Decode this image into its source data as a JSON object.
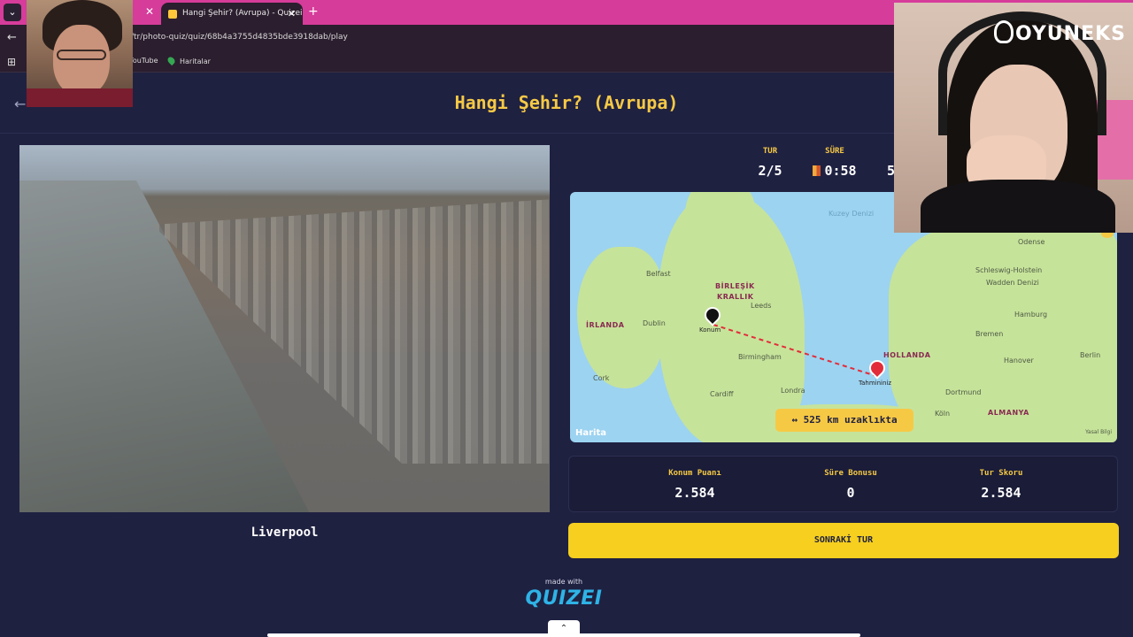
{
  "browser": {
    "active_tab_title": "Hangi Şehir? (Avrupa) - Quizei",
    "url": "/tr/photo-quiz/quiz/68b4a3755d4835bde3918dab/play",
    "bookmarks": [
      "YouTube",
      "Haritalar"
    ]
  },
  "page": {
    "title": "Hangi Şehir? (Avrupa)",
    "photo_caption": "Liverpool"
  },
  "stats": {
    "round_label": "TUR",
    "round_value": "2/5",
    "time_label": "SÜRE",
    "time_value": "0:58",
    "cut_value": "5"
  },
  "map": {
    "labels": {
      "ireland": "İRLANDA",
      "uk_line1": "BİRLEŞİK",
      "uk_line2": "KRALLIK",
      "netherlands": "HOLLANDA",
      "germany": "ALMANYA",
      "dublin": "Dublin",
      "belfast": "Belfast",
      "cork": "Cork",
      "leeds": "Leeds",
      "birmingham": "Birmingham",
      "cardiff": "Cardiff",
      "london": "Londra",
      "bremen": "Bremen",
      "hamburg": "Hamburg",
      "hanover": "Hanover",
      "berlin": "Berlin",
      "dortmund": "Dortmund",
      "koln": "Köln",
      "odense": "Odense",
      "schleswig": "Schleswig-Holstein",
      "wadden": "Wadden Denizi",
      "north_sea": "Kuzey Denizi"
    },
    "marker_actual_label": "Konum",
    "marker_guess_label": "Tahmininiz",
    "distance_text": "↔ 525 km uzaklıkta",
    "attribution": "Harita",
    "legal": "Yasal Bilgi"
  },
  "scores": {
    "location_label": "Konum Puanı",
    "location_value": "2.584",
    "time_bonus_label": "Süre Bonusu",
    "time_bonus_value": "0",
    "round_score_label": "Tur Skoru",
    "round_score_value": "2.584"
  },
  "next_button_label": "SONRAKİ TUR",
  "footer": {
    "made_with": "made with",
    "logo": "QUIZEI"
  },
  "overlay": {
    "brand": "OYUNEKS"
  },
  "colors": {
    "background": "#1f2141",
    "accent_yellow": "#f6c945",
    "button_yellow": "#f6cf1f",
    "tab_pink": "#d63c9a",
    "guess_red": "#e32c3a"
  }
}
